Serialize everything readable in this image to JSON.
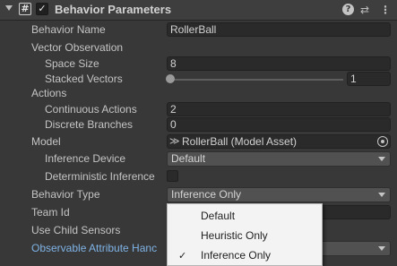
{
  "header": {
    "title": "Behavior Parameters",
    "help_icon": "help-icon",
    "presets_icon": "presets-icon",
    "menu_icon": "kebab-menu-icon"
  },
  "fields": {
    "behavior_name": {
      "label": "Behavior Name",
      "value": "RollerBall"
    },
    "vector_observation": {
      "label": "Vector Observation"
    },
    "space_size": {
      "label": "Space Size",
      "value": "8"
    },
    "stacked_vectors": {
      "label": "Stacked Vectors",
      "value": "1",
      "slider_level": 0
    },
    "actions": {
      "label": "Actions"
    },
    "continuous_actions": {
      "label": "Continuous Actions",
      "value": "2"
    },
    "discrete_branches": {
      "label": "Discrete Branches",
      "value": "0"
    },
    "model": {
      "label": "Model",
      "value": "RollerBall (Model Asset)"
    },
    "inference_device": {
      "label": "Inference Device",
      "value": "Default"
    },
    "deterministic_inference": {
      "label": "Deterministic Inference",
      "checked": false
    },
    "behavior_type": {
      "label": "Behavior Type",
      "value": "Inference Only"
    },
    "team_id": {
      "label": "Team Id"
    },
    "use_child_sensors": {
      "label": "Use Child Sensors"
    },
    "observable_attribute": {
      "label": "Observable Attribute Hanc"
    }
  },
  "popup": {
    "items": [
      {
        "label": "Default",
        "selected": false
      },
      {
        "label": "Heuristic Only",
        "selected": false
      },
      {
        "label": "Inference Only",
        "selected": true
      }
    ],
    "check_glyph": "✓"
  },
  "colors": {
    "background": "#383838",
    "field": "#2a2a2a",
    "dropdown": "#515151",
    "highlight_label": "#7fb3e6",
    "popup_bg": "#f3f3f3"
  }
}
